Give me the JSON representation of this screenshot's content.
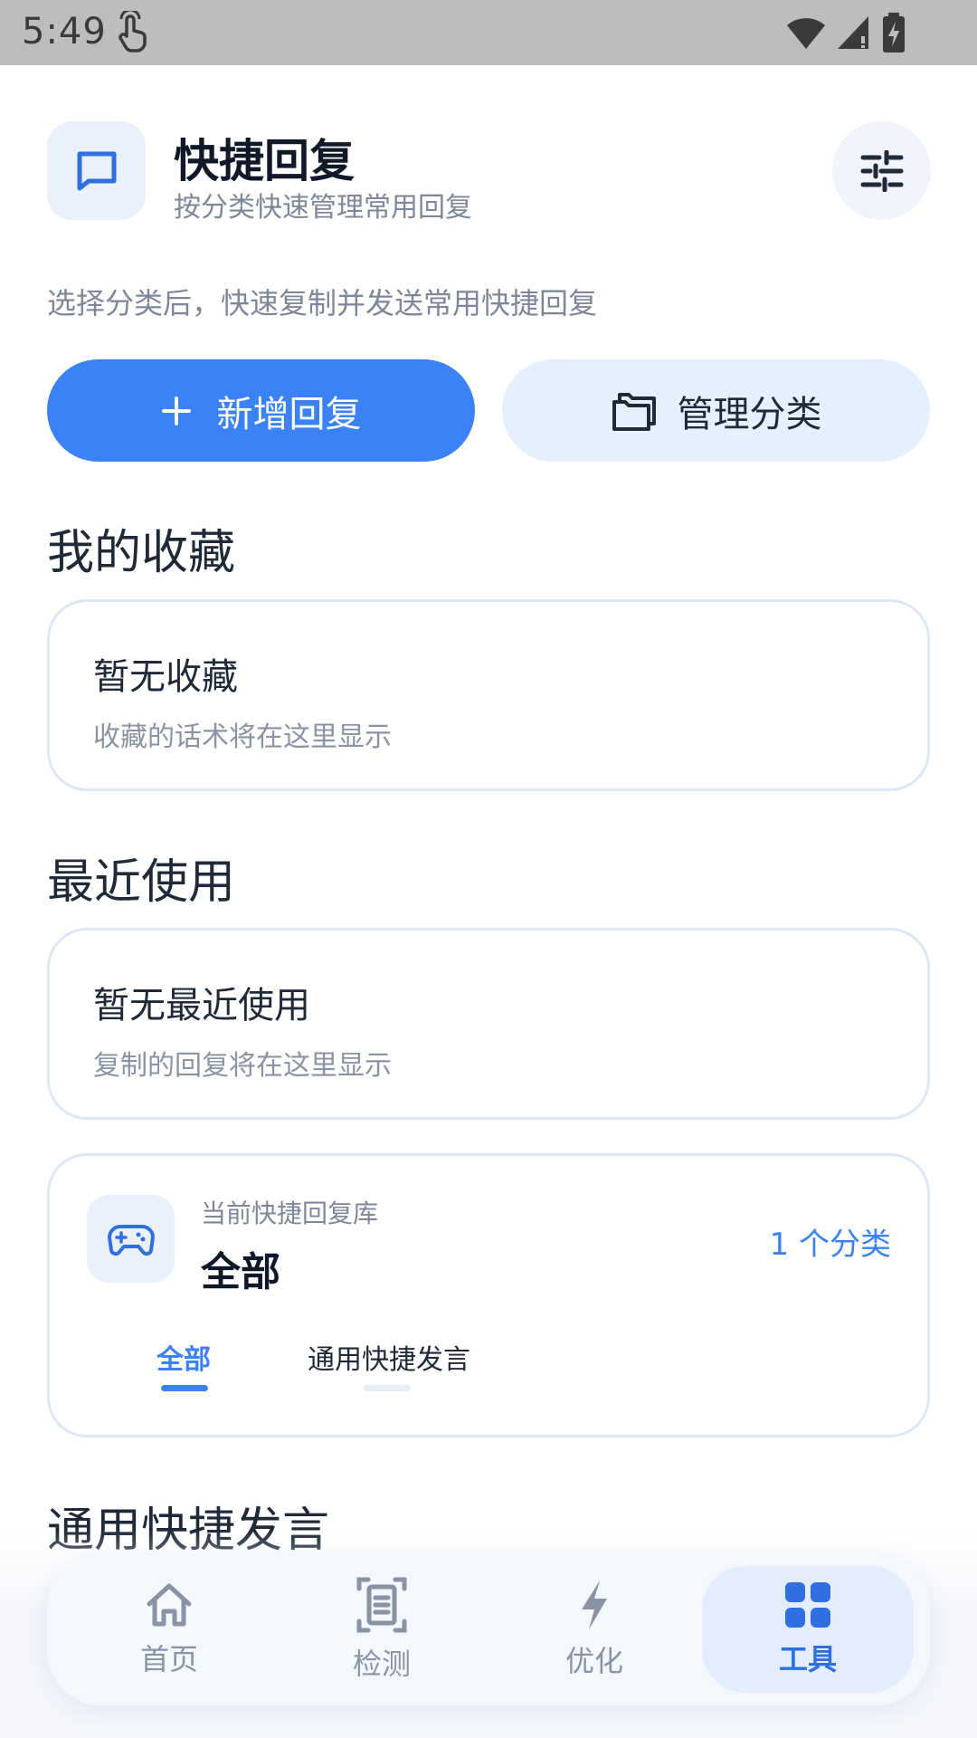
{
  "status_bar": {
    "time": "5:49"
  },
  "header": {
    "title": "快捷回复",
    "subtitle": "按分类快速管理常用回复"
  },
  "intro": "选择分类后，快速复制并发送常用快捷回复",
  "actions": {
    "add_label": "新增回复",
    "manage_label": "管理分类"
  },
  "favorites": {
    "title": "我的收藏",
    "empty_title": "暂无收藏",
    "empty_desc": "收藏的话术将在这里显示"
  },
  "recent": {
    "title": "最近使用",
    "empty_title": "暂无最近使用",
    "empty_desc": "复制的回复将在这里显示"
  },
  "library": {
    "caption": "当前快捷回复库",
    "name": "全部",
    "count": "1 个分类",
    "tabs": [
      {
        "label": "全部",
        "active": true
      },
      {
        "label": "通用快捷发言",
        "active": false
      }
    ]
  },
  "category_section": {
    "title": "通用快捷发言"
  },
  "bottom_nav": {
    "items": [
      {
        "label": "首页",
        "icon": "home-icon"
      },
      {
        "label": "检测",
        "icon": "scan-icon"
      },
      {
        "label": "优化",
        "icon": "lightning-icon"
      },
      {
        "label": "工具",
        "icon": "grid-icon",
        "active": true
      }
    ]
  },
  "colors": {
    "accent": "#3b82f6",
    "accent_light": "#eaf1fd",
    "text_primary": "#1f2937",
    "text_secondary": "#7d8799"
  }
}
